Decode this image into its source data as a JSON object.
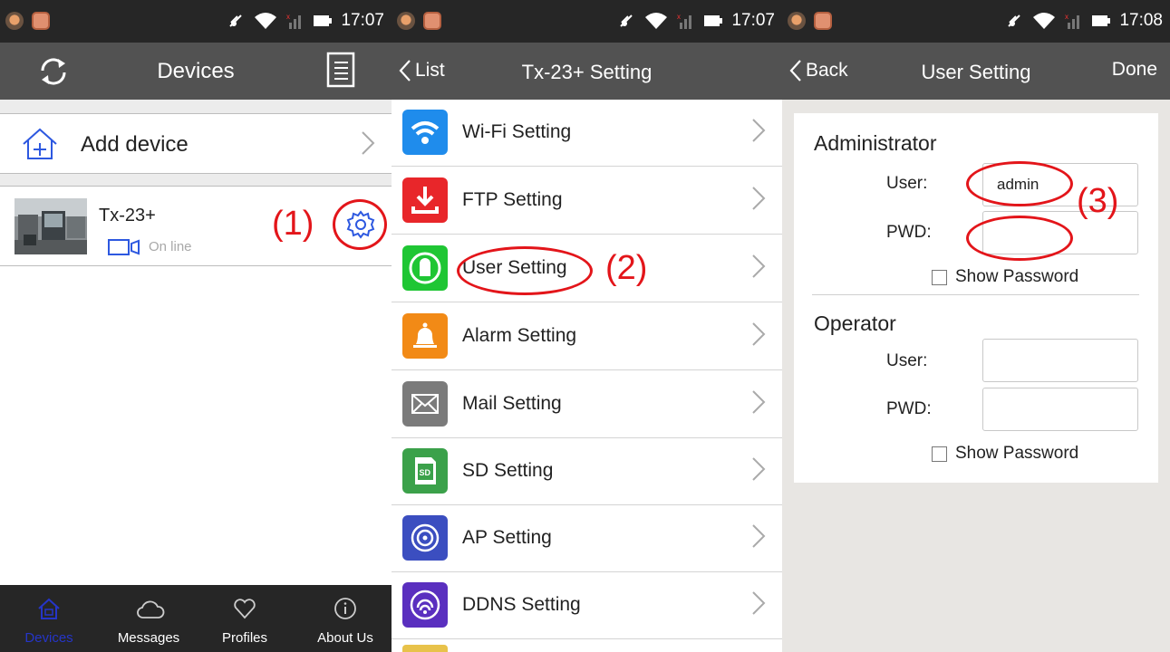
{
  "status_bars": [
    {
      "time": "17:07"
    },
    {
      "time": "17:07"
    },
    {
      "time": "17:08"
    }
  ],
  "devices_screen": {
    "title": "Devices",
    "add_device_label": "Add device",
    "device": {
      "name": "Tx-23+",
      "status": "On line"
    },
    "annotation": "(1)",
    "tabs": [
      {
        "label": "Devices",
        "icon": "home-icon",
        "active": true
      },
      {
        "label": "Messages",
        "icon": "cloud-icon",
        "active": false
      },
      {
        "label": "Profiles",
        "icon": "heart-icon",
        "active": false
      },
      {
        "label": "About Us",
        "icon": "info-icon",
        "active": false
      }
    ]
  },
  "settings_screen": {
    "back_label": "List",
    "title": "Tx-23+ Setting",
    "annotation": "(2)",
    "items": [
      {
        "label": "Wi-Fi Setting",
        "icon": "wifi-icon",
        "color": "#1f8cec"
      },
      {
        "label": "FTP Setting",
        "icon": "download-icon",
        "color": "#e8262a"
      },
      {
        "label": "User Setting",
        "icon": "user-icon",
        "color": "#1fc634"
      },
      {
        "label": "Alarm Setting",
        "icon": "bell-icon",
        "color": "#f28a16"
      },
      {
        "label": "Mail Setting",
        "icon": "mail-icon",
        "color": "#7b7b7b"
      },
      {
        "label": "SD Setting",
        "icon": "sd-card-icon",
        "color": "#3ba14a"
      },
      {
        "label": "AP Setting",
        "icon": "ap-icon",
        "color": "#3b4ec0"
      },
      {
        "label": "DDNS Setting",
        "icon": "ddns-icon",
        "color": "#5a2fbf"
      }
    ]
  },
  "user_screen": {
    "back_label": "Back",
    "title": "User Setting",
    "done_label": "Done",
    "annotation": "(3)",
    "administrator": {
      "heading": "Administrator",
      "user_label": "User:",
      "user_value": "admin",
      "pwd_label": "PWD:",
      "pwd_value": "",
      "show_password_label": "Show Password"
    },
    "operator": {
      "heading": "Operator",
      "user_label": "User:",
      "user_value": "",
      "pwd_label": "PWD:",
      "pwd_value": "",
      "show_password_label": "Show Password"
    }
  },
  "colors": {
    "status_bar": "#262626",
    "nav_bar": "#525252",
    "annotation_red": "#e3151a",
    "active_tab_blue": "#2535c8",
    "accent_blue": "#2d58e0"
  }
}
